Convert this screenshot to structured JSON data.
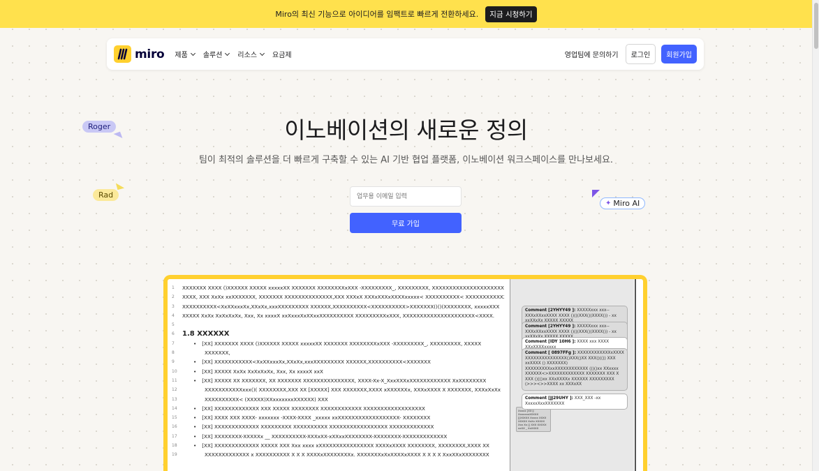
{
  "banner": {
    "text": "Miro의 최신 기능으로 아이디어를 임팩트로 빠르게 전환하세요.",
    "cta": "지금 시청하기"
  },
  "nav": {
    "logo_text": "miro",
    "items": [
      {
        "label": "제품",
        "dropdown": true
      },
      {
        "label": "솔루션",
        "dropdown": true
      },
      {
        "label": "리소스",
        "dropdown": true
      },
      {
        "label": "요금제",
        "dropdown": false
      }
    ],
    "contact_sales": "영업팀에 문의하기",
    "login": "로그인",
    "signup": "회원가입"
  },
  "cursors": {
    "roger": "Roger",
    "rad": "Rad",
    "miro_ai": "Miro AI"
  },
  "hero": {
    "title": "이노베이션의 새로운 정의",
    "subtitle": "팀이 최적의 솔루션을 더 빠르게 구축할 수 있는 AI 기반 협업 플랫폼, 이노베이션 워크스페이스를 만나보세요.",
    "email_placeholder": "업무용 이메일 입력",
    "cta": "무료 가입"
  },
  "document": {
    "lines": [
      {
        "n": "1",
        "text": "XXXXXXX XXXX ()XXXXXX XXXXX xxxxxXX XXXXXXX XXXXXXXXxXXX -XXXXXXXXX_, XXXXXXXXX, XXXXXXXXXXXXXXXXXXXXX."
      },
      {
        "n": "2",
        "text": "XXXX, XXX  XxXx xxXXXXXXX, XXXXXXX XXXXXXXXXXXXXX,XXX XXXxX XXXxXXXxXXXXxxxxx< XXXXXXXXXX< XXXXXXXXXXXXX"
      },
      {
        "n": "3",
        "text": "XXXXXXXXXX<XxXXxxxXx,XXxXx,xxxXXXXXXXXX XXXXXX,XXXXXXXXXX<XXXXXXXXXX>XXXXXXX()()(XXXXXXXX,  xxxxxXXX"
      },
      {
        "n": "4",
        "text": "XXXXX XxXx XxXxXxXx, Xxx, Xx xxxxX xxXxxxXxXXxxXXXXXXXXXX XXXXXXXXXxXXX, XXXXXXXXXXXXXXXXXXXXX<XXXX."
      },
      {
        "n": "5",
        "text": ""
      },
      {
        "n": "6",
        "text": "1.8 XXXXXX",
        "type": "heading"
      },
      {
        "n": "7",
        "text": "[XX]  XXXXXXX XXXX ()XXXXXX XXXXX xxxxxXX XXXXXXX XXXXXXXXxXXX -XXXXXXXXX_, XXXXXXXXX, XXXXX",
        "type": "bullet"
      },
      {
        "n": "8",
        "text": "XXXXXXX,",
        "type": "indent"
      },
      {
        "n": "9",
        "text": "[XX] XXXXXXXXXXX<XxXXxxxXx,XXxXx,xxxXXXXXXXXX XXXXXX,XXXXXXXXXX<XXXXXXX",
        "type": "bullet"
      },
      {
        "n": "10",
        "text": "[XX] XXXXX XxXx XxXxXxXx, Xxx, Xx xxxxX xxX",
        "type": "bullet"
      },
      {
        "n": "11",
        "text": "[XX]  XXXXX XX XXXXXXX, XX XXXXXXX XXXXXXXXXXXXXXX, XXXX-Xx-X_XxxXXXxXXXXXXXXXXXX XxXXXXXXXX",
        "type": "bullet"
      },
      {
        "n": "12",
        "text": "XXXXXXXXXXXxxx()( XXXXXXXX,XXX XX [XXXXX] XXX XXXXXXX,XXXX xXXXXXXx, XXXxXXXX X  XXXXXXX, XXXxXxXx",
        "type": "indent"
      },
      {
        "n": "13",
        "text": "XXXXXXXXXX< (XXXXX)XXxxxxxxxXXXXXX) XXX",
        "type": "indent"
      },
      {
        "n": "14",
        "text": "[XX] XXXXXXXXXXXXX XXX XXXXX XXXXXXXX XXXXXXXXXXXX XXXXXXXXXXXXXXXXXX",
        "type": "bullet"
      },
      {
        "n": "15",
        "text": "[XX] XXXX XXX XXXX- xxxxxxx -XXXX-XXXX _xxxxx  xxXXXXXXXXXXXXXXXXXX- XXXXXXXX",
        "type": "bullet"
      },
      {
        "n": "16",
        "text": "[XX] XXXXXXXXXXXXX XXXXXXXXX XXXXXXXXXX XXXXXXXXXXXXXXXXX XXXXXXXXXXXXX",
        "type": "bullet"
      },
      {
        "n": "17",
        "text": "[XX] XXXXXXXX-XXXXXx __ XXXXXXXXXX-XXXxXX-xXXxxXXXXXXXX-XXXXXXXX-XXXXXXXXXXXXX",
        "type": "bullet"
      },
      {
        "n": "18",
        "text": "[XX] XXXXXXXXXXXXX XXXXX XXX Xxx xxxx xXXXXXXXXXXXXXXXX XXXXxXXXX  XXXXXXXX, XXXXXXXX,XXXX XX",
        "type": "bullet"
      },
      {
        "n": "19",
        "text": "XXXXXXXXXXXXX x XXXXXXXXXX  X X X XXXXxXXXXXXXXx. XXXXXXXxXxXXXXxXXXX X X X X XxxXXxXXXXXXXX",
        "type": "indent"
      }
    ],
    "comments": [
      {
        "label": "Comment [2YHYY49 ]:",
        "text": "XXXXXxxx xxx-- XXXxXXxxXXXX XXXX ()()(XXX()(XXXX()) - xx xxXXxXx XXXXX XXXXX"
      },
      {
        "label": "Comment [2YHYY49 ]:",
        "text": "XXXXXxxx xxx-- XXXxXXxxXXXX XXXX ()()(XXX()(XXXX()) - xx xxXXxXx XXXXX XXXXX"
      },
      {
        "label": "Comment [IDY 10H6 ]:",
        "text": "XXXX xxx XXXX XXxXXXXxxxxx"
      },
      {
        "label": "Comment [ 0897FFg ]:",
        "text": "XXXXXXXXXXXXxXXXX XXXXXXXXXXXXXXX()XXX()XX XXX()(()) XXX xxXXXX () XXXXXXX)  XXXXXXXXXxxXXXXXXXXXXXX (()()xx XXxxxx XXXXXX<>XXXXXXXXXXXXX  XXXXXXX XXX X XXX ()(()xx XXxXXXXx XXXXXX  XXXXXXXXX (>>><>>XXXX xx XXXxXX"
      },
      {
        "label": "Comment [JJ29UHY ]:",
        "text": "XXX_XXX -xx XxxxxXxxXXXXXXX"
      }
    ],
    "mini_note": "Xxxxx [XX:]: XxxxxxxXXXXX [[XXXXX Xxxxx XXXX XXXXX XxXx XXXXX Xxx Xx [] XXX XXXXX xxXX _ XxXXXX"
  },
  "colors": {
    "banner_yellow": "#ffe14d",
    "brand_blue": "#4262ff",
    "frame_yellow": "#ffd02f"
  }
}
